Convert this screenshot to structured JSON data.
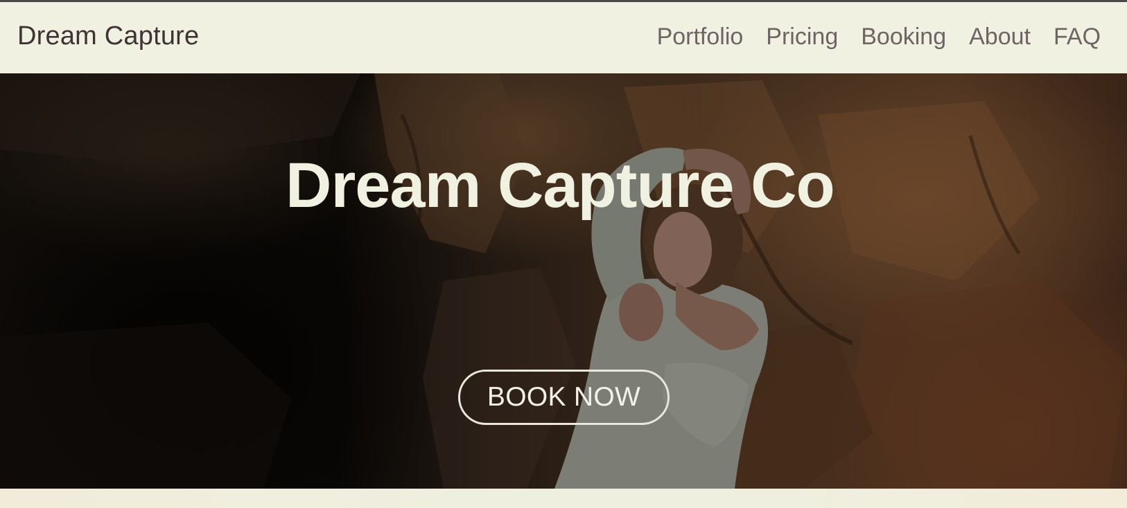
{
  "header": {
    "brand": "Dream Capture",
    "nav": [
      {
        "label": "Portfolio"
      },
      {
        "label": "Pricing"
      },
      {
        "label": "Booking"
      },
      {
        "label": "About"
      },
      {
        "label": "FAQ"
      }
    ]
  },
  "hero": {
    "title": "Dream Capture Co",
    "cta_label": "BOOK NOW"
  },
  "colors": {
    "nav_background": "#f0f1e1",
    "brand_text": "#3e3436",
    "nav_text": "#6e6466",
    "hero_text": "#f0f1e1"
  }
}
